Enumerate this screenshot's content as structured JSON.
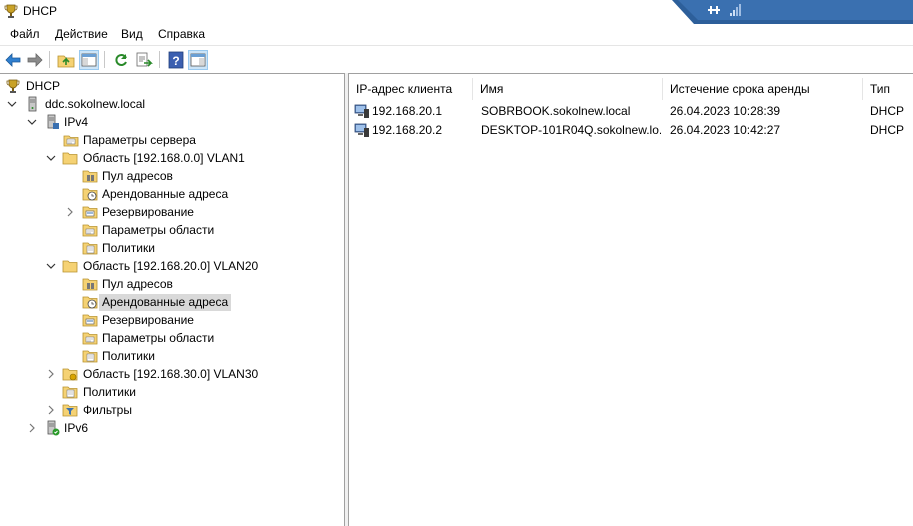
{
  "window": {
    "title": "DHCP"
  },
  "menu": [
    "Файл",
    "Действие",
    "Вид",
    "Справка"
  ],
  "toolbar": {
    "buttons": [
      "back-icon",
      "forward-icon",
      "up-folder-icon",
      "show-hide-console-tree-icon",
      "refresh-icon",
      "export-list-icon",
      "help-icon",
      "show-hide-action-pane-icon"
    ]
  },
  "tree": {
    "root": "DHCP",
    "server": "ddc.sokolnew.local",
    "ipv4": "IPv4",
    "server_options": "Параметры сервера",
    "scope1": {
      "label": "Область [192.168.0.0] VLAN1",
      "pool": "Пул адресов",
      "leases": "Арендованные адреса",
      "reservations": "Резервирование",
      "options": "Параметры области",
      "policies": "Политики"
    },
    "scope2": {
      "label": "Область [192.168.20.0] VLAN20",
      "pool": "Пул адресов",
      "leases": "Арендованные адреса",
      "reservations": "Резервирование",
      "options": "Параметры области",
      "policies": "Политики"
    },
    "scope3": {
      "label": "Область [192.168.30.0] VLAN30"
    },
    "policies": "Политики",
    "filters": "Фильтры",
    "ipv6": "IPv6"
  },
  "list": {
    "columns": [
      "IP-адрес клиента",
      "Имя",
      "Истечение срока аренды",
      "Тип"
    ],
    "rows": [
      {
        "ip": "192.168.20.1",
        "name": "SOBRBOOK.sokolnew.local",
        "expires": "26.04.2023 10:28:39",
        "type": "DHCP"
      },
      {
        "ip": "192.168.20.2",
        "name": "DESKTOP-101R04Q.sokolnew.lo...",
        "expires": "26.04.2023 10:42:27",
        "type": "DHCP"
      }
    ]
  },
  "colors": {
    "selection": "#d9d9d9",
    "toolbar_active": "#cce4f7",
    "rdp_bar": "#2d5f9a",
    "folder": "#f5d274"
  }
}
